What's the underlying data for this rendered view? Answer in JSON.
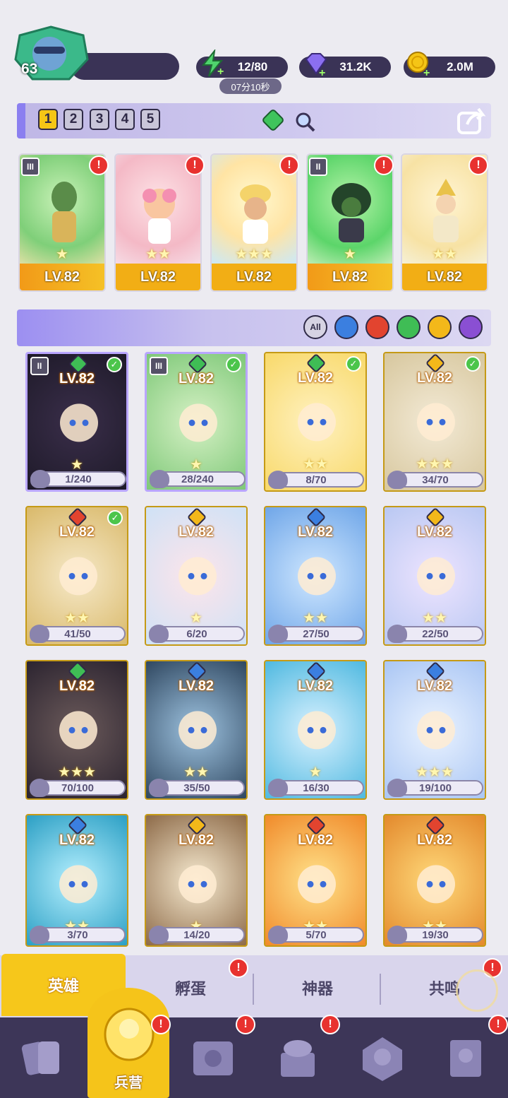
{
  "player": {
    "level": "63"
  },
  "resources": [
    {
      "name": "energy",
      "icon": "lightning-icon",
      "value": "12/80"
    },
    {
      "name": "gems",
      "icon": "gem-icon",
      "value": "31.2K"
    },
    {
      "name": "gold",
      "icon": "coin-icon",
      "value": "2.0M"
    }
  ],
  "energy_timer": "07分10秒",
  "team_tabs": [
    "1",
    "2",
    "3",
    "4",
    "5"
  ],
  "team_tab_selected": "1",
  "team_cards": [
    {
      "level": "LV.82",
      "element": "wind"
    },
    {
      "level": "LV.82",
      "element": "wind"
    },
    {
      "level": "LV.82",
      "element": "light"
    },
    {
      "level": "LV.82",
      "element": "wind"
    },
    {
      "level": "LV.82",
      "element": "fire"
    }
  ],
  "filters": {
    "all_label": "All",
    "elements": [
      "water",
      "fire",
      "wind",
      "light",
      "dark"
    ]
  },
  "heroes": [
    {
      "level": "LV.82",
      "progress": "1/240",
      "element": "wind",
      "checked": true
    },
    {
      "level": "LV.82",
      "progress": "28/240",
      "element": "wind",
      "checked": true
    },
    {
      "level": "LV.82",
      "progress": "8/70",
      "element": "wind",
      "checked": true
    },
    {
      "level": "LV.82",
      "progress": "34/70",
      "element": "light",
      "checked": true
    },
    {
      "level": "LV.82",
      "progress": "41/50",
      "element": "fire",
      "checked": true
    },
    {
      "level": "LV.82",
      "progress": "6/20",
      "element": "light",
      "checked": false
    },
    {
      "level": "LV.82",
      "progress": "27/50",
      "element": "water",
      "checked": false
    },
    {
      "level": "LV.82",
      "progress": "22/50",
      "element": "light",
      "checked": false
    },
    {
      "level": "LV.82",
      "progress": "70/100",
      "element": "wind",
      "checked": false
    },
    {
      "level": "LV.82",
      "progress": "35/50",
      "element": "water",
      "checked": false
    },
    {
      "level": "LV.82",
      "progress": "16/30",
      "element": "water",
      "checked": false
    },
    {
      "level": "LV.82",
      "progress": "19/100",
      "element": "water",
      "checked": false
    },
    {
      "level": "LV.82",
      "progress": "3/70",
      "element": "water",
      "checked": false
    },
    {
      "level": "LV.82",
      "progress": "14/20",
      "element": "light",
      "checked": false
    },
    {
      "level": "LV.82",
      "progress": "5/70",
      "element": "fire",
      "checked": false
    },
    {
      "level": "LV.82",
      "progress": "19/30",
      "element": "fire",
      "checked": false
    }
  ],
  "sub_tabs": [
    "英雄",
    "孵蛋",
    "神器",
    "共鸣"
  ],
  "sub_tab_active": "英雄",
  "nav": {
    "active_label": "兵营"
  },
  "colors": {
    "accent": "#f5c41a",
    "panel": "#3d3658",
    "badge": "#e8322f"
  }
}
